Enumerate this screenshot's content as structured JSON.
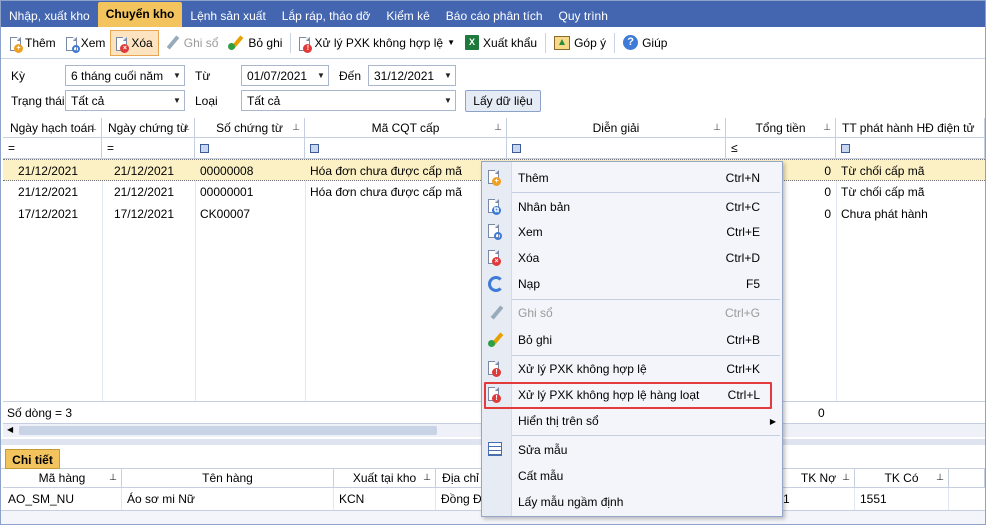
{
  "tabs": [
    {
      "label": "Nhập, xuất kho",
      "active": false
    },
    {
      "label": "Chuyển kho",
      "active": true
    },
    {
      "label": "Lệnh sản xuất",
      "active": false
    },
    {
      "label": "Lắp ráp, tháo dỡ",
      "active": false
    },
    {
      "label": "Kiểm kê",
      "active": false
    },
    {
      "label": "Báo cáo phân tích",
      "active": false
    },
    {
      "label": "Quy trình",
      "active": false
    }
  ],
  "toolbar": {
    "add": "Thêm",
    "view": "Xem",
    "delete": "Xóa",
    "post": "Ghi sổ",
    "unpost": "Bỏ ghi",
    "process_invalid": "Xử lý PXK không hợp lệ",
    "export": "Xuất khẩu",
    "feedback": "Góp ý",
    "help": "Giúp"
  },
  "filter": {
    "period_label": "Kỳ",
    "period_value": "6 tháng cuối năm",
    "from_label": "Từ",
    "from_value": "01/07/2021",
    "to_label": "Đến",
    "to_value": "31/12/2021",
    "status_label": "Trạng thái",
    "status_value": "Tất cả",
    "type_label": "Loại",
    "type_value": "Tất cả",
    "fetch_button": "Lấy dữ liệu"
  },
  "grid": {
    "columns": [
      "Ngày hạch toán",
      "Ngày chứng từ",
      "Số chứng từ",
      "Mã CQT cấp",
      "Diễn giải",
      "Tổng tiền",
      "TT phát hành HĐ điện tử"
    ],
    "filter_ops": [
      "=",
      "=",
      "",
      "",
      "",
      "≤",
      ""
    ],
    "rows": [
      {
        "posting_date": "21/12/2021",
        "doc_date": "21/12/2021",
        "doc_no": "00000008",
        "tax_code": "Hóa đơn chưa được cấp mã",
        "desc": "",
        "total": "0",
        "einvoice_status": "Từ chối cấp mã"
      },
      {
        "posting_date": "21/12/2021",
        "doc_date": "21/12/2021",
        "doc_no": "00000001",
        "tax_code": "Hóa đơn chưa được cấp mã",
        "desc": "",
        "total": "0",
        "einvoice_status": "Từ chối cấp mã"
      },
      {
        "posting_date": "17/12/2021",
        "doc_date": "17/12/2021",
        "doc_no": "CK00007",
        "tax_code": "",
        "desc": "",
        "total": "0",
        "einvoice_status": "Chưa phát hành"
      }
    ],
    "row_count": "Số dòng = 3",
    "sum_total": "0"
  },
  "context_menu": {
    "items": [
      {
        "label": "Thêm",
        "shortcut": "Ctrl+N",
        "disabled": false
      },
      {
        "label": "Nhân bản",
        "shortcut": "Ctrl+C",
        "disabled": false
      },
      {
        "label": "Xem",
        "shortcut": "Ctrl+E",
        "disabled": false
      },
      {
        "label": "Xóa",
        "shortcut": "Ctrl+D",
        "disabled": false
      },
      {
        "label": "Nạp",
        "shortcut": "F5",
        "disabled": false
      },
      {
        "label": "Ghi sổ",
        "shortcut": "Ctrl+G",
        "disabled": true
      },
      {
        "label": "Bỏ ghi",
        "shortcut": "Ctrl+B",
        "disabled": false
      },
      {
        "label": "Xử lý PXK không hợp lệ",
        "shortcut": "Ctrl+K",
        "disabled": false
      },
      {
        "label": "Xử lý PXK không hợp lệ hàng loạt",
        "shortcut": "Ctrl+L",
        "disabled": false
      },
      {
        "label": "Hiển thị trên sổ",
        "shortcut": "",
        "disabled": false
      },
      {
        "label": "Sửa mẫu",
        "shortcut": "",
        "disabled": false
      },
      {
        "label": "Cất mẫu",
        "shortcut": "",
        "disabled": false
      },
      {
        "label": "Lấy mẫu ngầm định",
        "shortcut": "",
        "disabled": false
      }
    ]
  },
  "detail": {
    "tab_label": "Chi tiết",
    "columns": [
      "Mã hàng",
      "Tên hàng",
      "Xuất tại kho",
      "Địa chỉ",
      "TK Nợ",
      "TK Có"
    ],
    "rows": [
      {
        "item_code": "AO_SM_NU",
        "item_name": "Áo sơ mi Nữ",
        "warehouse": "KCN",
        "address": "Đồng Đa",
        "debit": "1",
        "credit": "1551"
      }
    ]
  },
  "colors": {
    "accent": "#4466b0",
    "active_tab": "#f3c45d",
    "selected_row": "#fcf1c4",
    "highlight_border": "#e33b3b"
  }
}
